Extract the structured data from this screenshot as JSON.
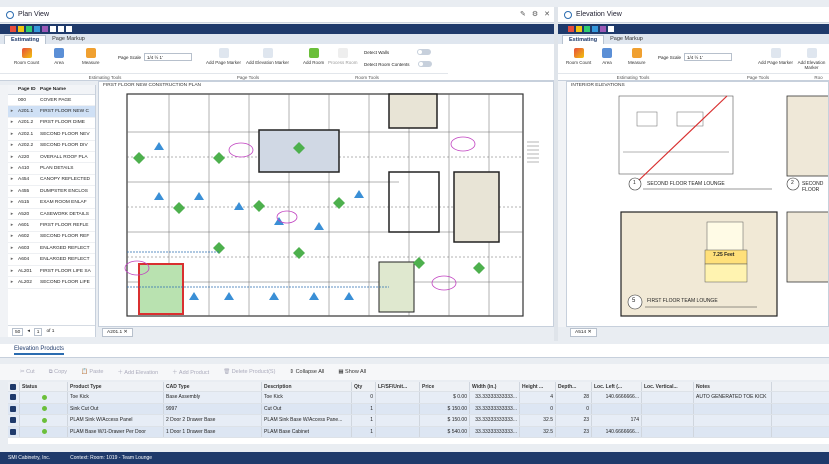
{
  "plan_view": {
    "title": "Plan View",
    "tabs": [
      "Estimating",
      "Page Markup"
    ],
    "tools": {
      "room_count": "Room Count",
      "area": "Area",
      "measure": "Measure",
      "page_scale_label": "Page Scale",
      "page_scale_value": "1/4 ½ 1'",
      "add_page_marker": "Add Page Marker",
      "add_elevation_marker": "Add Elevation Marker",
      "add_room": "Add Room",
      "process_room": "Process Room",
      "detect_walls": "Detect Walls",
      "detect_room_contents": "Detect Room Contents"
    },
    "groups": {
      "estimating_tools": "Estimating Tools",
      "page_tools": "Page Tools",
      "room_tools": "Room Tools"
    },
    "pages_header": {
      "page_id": "Page ID",
      "page_name": "Page Name"
    },
    "pages": [
      {
        "id": "000",
        "name": "COVER PAGE"
      },
      {
        "id": "A201.1",
        "name": "FIRST FLOOR NEW C"
      },
      {
        "id": "A201.2",
        "name": "FIRST FLOOR DIME"
      },
      {
        "id": "A202.1",
        "name": "SECOND FLOOR NEV"
      },
      {
        "id": "A202.2",
        "name": "SECOND FLOOR DIV"
      },
      {
        "id": "A220",
        "name": "OVERALL ROOF PLA"
      },
      {
        "id": "A410",
        "name": "PLAN DETAILS"
      },
      {
        "id": "A454",
        "name": "CANOPY REFLECTED"
      },
      {
        "id": "A455",
        "name": "DUMPSTER ENCLOS"
      },
      {
        "id": "A515",
        "name": "EXAM ROOM ENLAF"
      },
      {
        "id": "A520",
        "name": "CASEWORK DETAILS"
      },
      {
        "id": "A601",
        "name": "FIRST FLOOR REFLE"
      },
      {
        "id": "A602",
        "name": "SECOND FLOOR REF"
      },
      {
        "id": "A603",
        "name": "ENLARGED REFLECT"
      },
      {
        "id": "A604",
        "name": "ENLARGED REFLECT"
      },
      {
        "id": "AL201",
        "name": "FIRST FLOOR LIFE SA"
      },
      {
        "id": "AL202",
        "name": "SECOND FLOOR LIFE"
      }
    ],
    "pager": {
      "page_size": "50",
      "page_num": "1",
      "of_label": "of 1"
    },
    "drawing_title": "FIRST FLOOR NEW CONSTRUCTION PLAN",
    "sheet_tab": "A201.1"
  },
  "elevation_view": {
    "title": "Elevation View",
    "tabs": [
      "Estimating",
      "Page Markup"
    ],
    "tools": {
      "room_count": "Room Count",
      "area": "Area",
      "measure": "Measure",
      "page_scale_label": "Page Scale",
      "page_scale_value": "1/4 ½ 1'",
      "add_page_marker": "Add Page Marker",
      "add_elevation_marker": "Add Elevation Marker",
      "add_room": "Add Room"
    },
    "groups": {
      "estimating_tools": "Estimating Tools",
      "page_tools": "Page Tools",
      "room_tools": "Roo"
    },
    "drawing_title": "INTERIOR ELEVATIONS",
    "labels": {
      "n1": "1",
      "t1": "SECOND FLOOR TEAM LOUNGE",
      "n2": "2",
      "t2": "SECOND FLOOR",
      "n5": "5",
      "t5": "FIRST FLOOR TEAM LOUNGE",
      "feet": "7.25 Feet"
    },
    "sheet_tab": "A514"
  },
  "elevation_products": {
    "title": "Elevation Products",
    "toolbar": {
      "cut": "Cut",
      "copy": "Copy",
      "paste": "Paste",
      "add_elevation": "Add Elevation",
      "add_product": "Add Product",
      "delete_product": "Delete Product(S)",
      "collapse_all": "Collapse All",
      "show_all": "Show All"
    },
    "columns": [
      "Status",
      "Product Type",
      "CAD Type",
      "Description",
      "Qty",
      "LF/SF/Unit...",
      "Price",
      "Width (in.)",
      "Height ...",
      "Depth...",
      "Loc. Left (...",
      "Loc. Vertical...",
      "Notes"
    ],
    "rows": [
      [
        "Toe Kick",
        "Base Assembly",
        "Toe Kick",
        "0",
        "",
        "$ 0.00",
        "33.33333333333...",
        "4",
        "28",
        "140.6666666...",
        "",
        "AUTO GENERATED TOE KICK"
      ],
      [
        "Sink Cut Out",
        "9997",
        "Cut Out",
        "1",
        "",
        "$ 150.00",
        "33.33333333333...",
        "0",
        "0",
        "",
        "",
        ""
      ],
      [
        "PLAM Sink W/Access Panel",
        "2 Door 2 Drawer Base",
        "PLAM Sink Base W/Access Pane...",
        "1",
        "",
        "$ 150.00",
        "33.33333333333...",
        "32.5",
        "23",
        "174",
        "",
        ""
      ],
      [
        "PLAM Base W/1-Drawer Per Door",
        "1 Door 1 Drawer Base",
        "PLAM Base Cabinet",
        "1",
        "",
        "$ 540.00",
        "33.33333333333...",
        "32.5",
        "23",
        "140.6666666...",
        "",
        ""
      ]
    ]
  },
  "status_bar": {
    "company": "SMI Cabinetry, Inc.",
    "context": "Context: Room: 1019 - Team Lounge"
  },
  "colors": {
    "navy": "#1f3a6b",
    "accent": "#2b6cb0",
    "status_ok": "#6bbf3a",
    "markup": "#d93030",
    "highlight": "#cfe0f5"
  }
}
